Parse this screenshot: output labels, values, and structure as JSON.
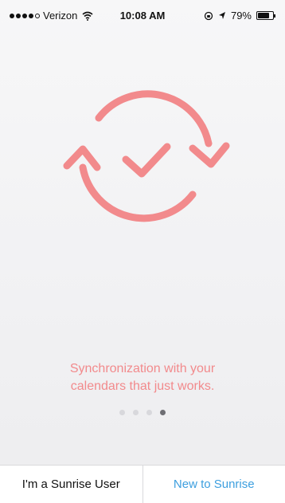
{
  "status_bar": {
    "signal_bars_filled": 4,
    "signal_bars_total": 5,
    "carrier": "Verizon",
    "time": "10:08 AM",
    "battery_percent_label": "79%",
    "battery_level": 0.79,
    "icons": [
      "wifi-icon",
      "orientation-lock-icon",
      "location-arrow-icon",
      "battery-icon"
    ]
  },
  "illustration": {
    "name": "sync-check-icon",
    "color": "#f28a8c"
  },
  "tagline": {
    "line1": "Synchronization with your",
    "line2": "calendars that just works."
  },
  "pager": {
    "total": 4,
    "active_index": 3
  },
  "bottom_bar": {
    "existing_user_label": "I'm a Sunrise User",
    "new_user_label": "New to Sunrise",
    "accent_color": "#3d9fdf"
  }
}
